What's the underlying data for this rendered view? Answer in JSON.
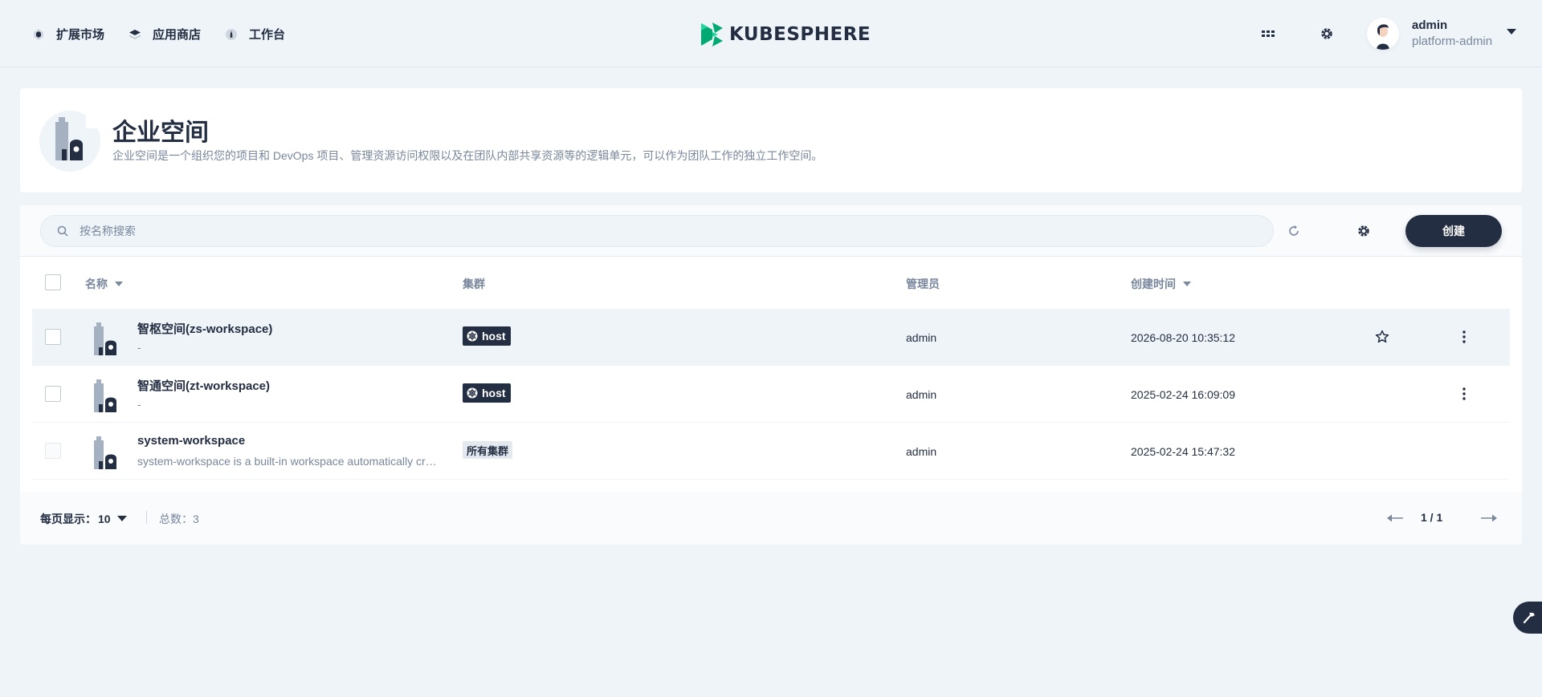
{
  "nav": {
    "items": [
      {
        "label": "扩展市场",
        "icon": "extension-market-icon"
      },
      {
        "label": "应用商店",
        "icon": "app-store-icon"
      },
      {
        "label": "工作台",
        "icon": "workbench-icon"
      }
    ]
  },
  "brand": {
    "name": "KUBESPHERE",
    "accent": "#00aa72"
  },
  "header": {
    "apps_icon": "apps-grid-icon",
    "settings_icon": "gear-icon"
  },
  "user": {
    "name": "admin",
    "role": "platform-admin"
  },
  "banner": {
    "title": "企业空间",
    "description": "企业空间是一个组织您的项目和 DevOps 项目、管理资源访问权限以及在团队内部共享资源等的逻辑单元，可以作为团队工作的独立工作空间。"
  },
  "toolbar": {
    "search_placeholder": "按名称搜索",
    "search_value": "",
    "create_label": "创建"
  },
  "table": {
    "columns": {
      "name": "名称",
      "cluster": "集群",
      "manager": "管理员",
      "created": "创建时间"
    },
    "rows": [
      {
        "name": "智枢空间(zs-workspace)",
        "desc": "-",
        "cluster": "host",
        "manager": "admin",
        "created": "2026-08-20 10:35:12",
        "starred": false
      },
      {
        "name": "智通空间(zt-workspace)",
        "desc": "-",
        "cluster": "host",
        "manager": "admin",
        "created": "2025-02-24 16:09:09",
        "starred": false
      },
      {
        "name": "system-workspace",
        "desc": "system-workspace is a built-in workspace automatically created by KubeSphere. It contains all system components to run KubeSphere.",
        "cluster": "所有集群",
        "manager": "admin",
        "created": "2025-02-24 15:47:32",
        "starred": false
      }
    ]
  },
  "footer": {
    "per_page_label": "每页显示：",
    "per_page_value": "10",
    "total_label": "总数：",
    "total_value": "3",
    "page_text": "1 / 1"
  },
  "colors": {
    "dark": "#242e42",
    "muted": "#79879c",
    "background": "#eff4f9"
  }
}
